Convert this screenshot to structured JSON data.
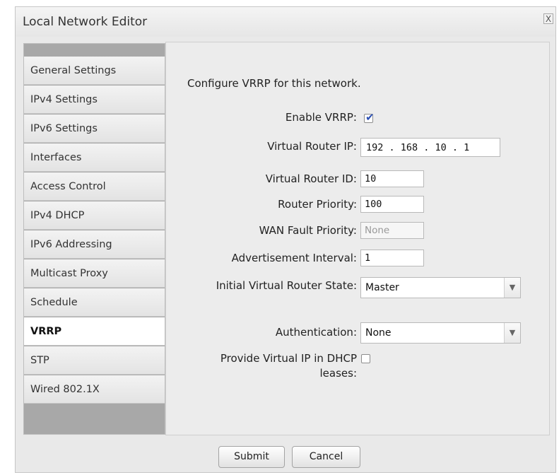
{
  "window": {
    "title": "Local Network Editor",
    "close_label": "X"
  },
  "sidebar": {
    "items": [
      {
        "label": "General Settings"
      },
      {
        "label": "IPv4 Settings"
      },
      {
        "label": "IPv6 Settings"
      },
      {
        "label": "Interfaces"
      },
      {
        "label": "Access Control"
      },
      {
        "label": "IPv4 DHCP"
      },
      {
        "label": "IPv6 Addressing"
      },
      {
        "label": "Multicast Proxy"
      },
      {
        "label": "Schedule"
      },
      {
        "label": "VRRP"
      },
      {
        "label": "STP"
      },
      {
        "label": "Wired 802.1X"
      }
    ],
    "active": "VRRP"
  },
  "content": {
    "intro": "Configure VRRP for this network.",
    "enable_vrrp": {
      "label": "Enable VRRP:",
      "checked": true
    },
    "virtual_router_ip": {
      "label": "Virtual Router IP:",
      "value": "192 . 168 . 10  .  1"
    },
    "virtual_router_id": {
      "label": "Virtual Router ID:",
      "value": "10"
    },
    "router_priority": {
      "label": "Router Priority:",
      "value": "100"
    },
    "wan_fault_priority": {
      "label": "WAN Fault Priority:",
      "value": "None"
    },
    "advertisement_interval": {
      "label": "Advertisement Interval:",
      "value": "1"
    },
    "initial_state": {
      "label": "Initial Virtual Router State:",
      "value": "Master"
    },
    "authentication": {
      "label": "Authentication:",
      "value": "None"
    },
    "provide_virtual_ip": {
      "label": "Provide Virtual IP in DHCP leases:",
      "checked": false
    }
  },
  "footer": {
    "submit_label": "Submit",
    "cancel_label": "Cancel"
  }
}
